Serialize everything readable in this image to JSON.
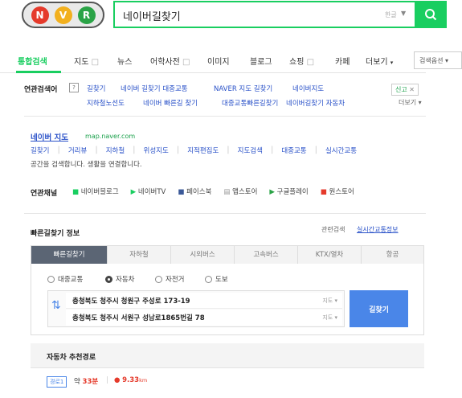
{
  "logo": {
    "letters": [
      "N",
      "V",
      "R"
    ]
  },
  "search": {
    "value": "네이버길찾기",
    "kb_label": "한글"
  },
  "tabs": {
    "items": [
      "통합검색",
      "지도",
      "뉴스",
      "어학사전",
      "이미지",
      "블로그",
      "쇼핑",
      "카페",
      "더보기"
    ],
    "option": "검색옵션"
  },
  "related": {
    "label": "연관검색어",
    "help": "?",
    "row1": [
      "길찾기",
      "네이버 길찾기 대중교통",
      "NAVER 지도 길찾기",
      "네이버지도"
    ],
    "row2": [
      "지하철노선도",
      "네이버 빠른길 찾기",
      "대중교통빠른길찾기",
      "네이버길찾기 자동차"
    ],
    "report": "신고",
    "more": "더보기"
  },
  "map_result": {
    "title": "네이버 지도",
    "url": "map.naver.com",
    "links": [
      "길찾기",
      "거리뷰",
      "지하철",
      "위성지도",
      "지적편집도",
      "지도검색",
      "대중교통",
      "실시간교통"
    ],
    "desc": "공간을 검색합니다. 생활을 연결합니다."
  },
  "channels": {
    "label": "연관채널",
    "items": [
      "네이버블로그",
      "네이버TV",
      "페이스북",
      "앱스토어",
      "구글플레이",
      "원스토어"
    ]
  },
  "directions": {
    "title": "빠른길찾기 정보",
    "links": [
      "관련검색",
      "실시간교통정보"
    ],
    "tabs": [
      "빠른길찾기",
      "자하철",
      "시외버스",
      "고속버스",
      "KTX/열차",
      "항공"
    ],
    "modes": [
      "대중교통",
      "자동차",
      "자전거",
      "도보"
    ],
    "origin": "충청북도 청주시 청원구 주성로 173-19",
    "destination": "충청북도 청주시 서원구 성남로1865번길 78",
    "addr_tag": "지도",
    "find_button": "길찾기",
    "recommend_title": "자동차 추천경로",
    "route_badge": "경로1",
    "route_time_label": "약",
    "route_time": "33분",
    "route_dist": "9.33",
    "route_dist_unit": "km"
  },
  "colors": {
    "brand_green": "#19ce60",
    "link_blue": "#2850c8",
    "active_tab_bg": "#5b6574",
    "find_button": "#4a86e8"
  }
}
